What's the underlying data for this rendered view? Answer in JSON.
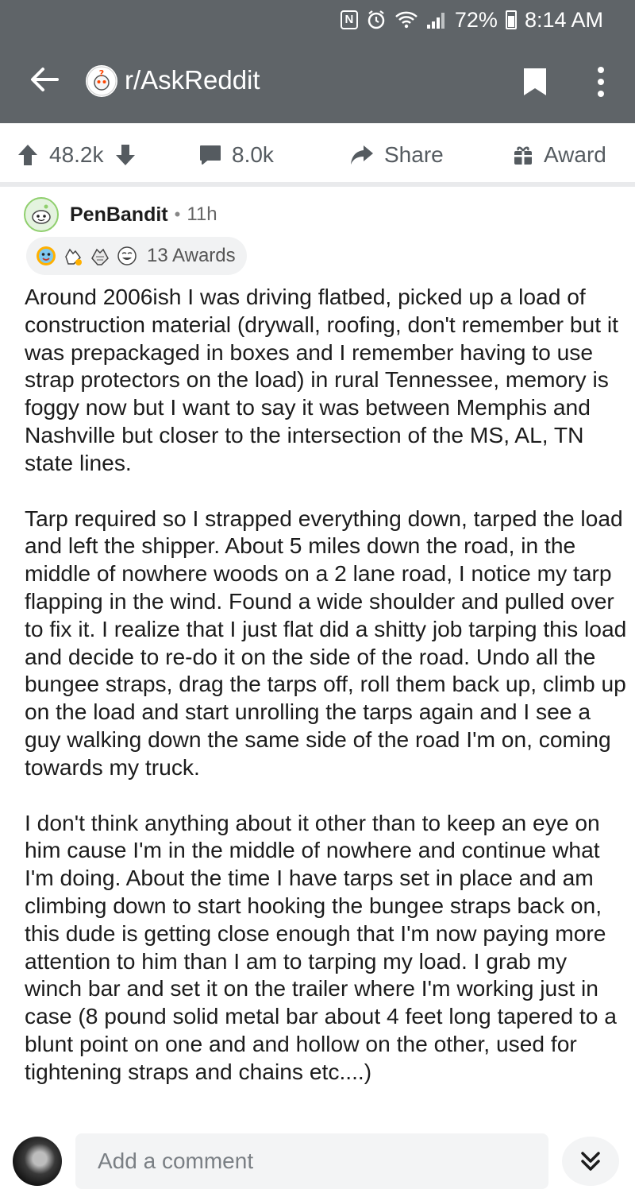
{
  "status_bar": {
    "nfc_label": "N",
    "battery_percent": "72%",
    "time": "8:14 AM"
  },
  "header": {
    "subreddit": "r/AskReddit"
  },
  "actions": {
    "upvotes": "48.2k",
    "comments": "8.0k",
    "share_label": "Share",
    "award_label": "Award"
  },
  "post": {
    "author": "PenBandit",
    "separator": "•",
    "age": "11h",
    "awards_label": "13 Awards",
    "paragraphs": [
      "Around 2006ish I was driving flatbed, picked up a load of construction material (drywall, roofing, don't remember but it was prepackaged in boxes and I remember having to use strap protectors on the load) in rural Tennessee, memory is foggy now but I want to say it was between Memphis and Nashville but closer to the intersection of the MS, AL, TN state lines.",
      "Tarp required so I strapped everything down, tarped the load and left the shipper.  About 5 miles down the road, in the middle of nowhere woods on a 2 lane road, I notice my tarp flapping in the wind.  Found a wide shoulder and pulled over to fix it.  I realize that I just flat did a shitty job tarping this load and decide to re-do it on the side of the road.  Undo all the bungee straps, drag the tarps off, roll them back up, climb up on the load and start unrolling the tarps again and I see a guy walking down the same side of the road I'm on, coming towards my truck.",
      "I don't think anything about it other than to keep an eye on him cause I'm in the middle of nowhere and continue what I'm doing.  About the time I have tarps set in place and am climbing down to start hooking the bungee straps back on, this dude is getting close enough that I'm now paying more attention to him than I am to tarping my load.  I grab my winch bar and set it on the trailer where I'm working just in case (8 pound solid metal bar about 4 feet long tapered to a blunt point on one and and hollow on the other, used for tightening straps and chains etc....)"
    ]
  },
  "comment_bar": {
    "placeholder": "Add a comment"
  },
  "colors": {
    "header_bg": "#5f6468",
    "action_text": "#555b60",
    "divider": "#e9eaec"
  }
}
